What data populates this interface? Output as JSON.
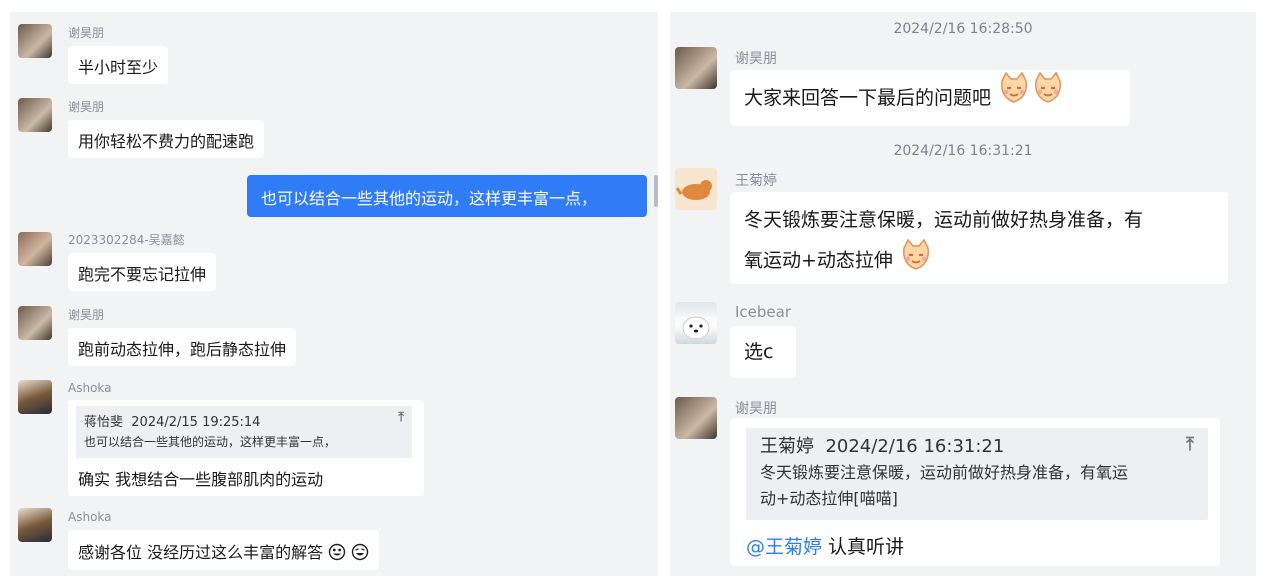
{
  "left": {
    "messages": [
      {
        "sender": "谢昊朋",
        "text": "半小时至少"
      },
      {
        "sender": "谢昊朋",
        "text": "用你轻松不费力的配速跑"
      },
      {
        "self": true,
        "text": "也可以结合一些其他的运动，这样更丰富一点，"
      },
      {
        "sender": "2023302284-吴嘉懿",
        "text": "跑完不要忘记拉伸"
      },
      {
        "sender": "谢昊朋",
        "text": "跑前动态拉伸，跑后静态拉伸"
      },
      {
        "sender": "Ashoka",
        "quote": {
          "author": "蒋怡斐",
          "time": "2024/2/15 19:25:14",
          "text": "也可以结合一些其他的运动，这样更丰富一点，"
        },
        "text": "确实 我想结合一些腹部肌肉的运动"
      },
      {
        "sender": "Ashoka",
        "text": "感谢各位 没经历过这么丰富的解答"
      }
    ]
  },
  "right": {
    "timestamp_1": "2024/2/16 16:28:50",
    "timestamp_2": "2024/2/16 16:31:21",
    "messages": [
      {
        "sender": "谢昊朋",
        "text": "大家来回答一下最后的问题吧"
      },
      {
        "sender": "王菊婷",
        "text_line1": "冬天锻炼要注意保暖，运动前做好热身准备，有",
        "text_line2": "氧运动+动态拉伸"
      },
      {
        "sender": "Icebear",
        "text": "选c"
      },
      {
        "sender": "谢昊朋",
        "quote": {
          "author": "王菊婷",
          "time": "2024/2/16 16:31:21",
          "line1": "冬天锻炼要注意保暖，运动前做好热身准备，有氧运",
          "line2": "动+动态拉伸[喵喵]"
        },
        "mention": "@王菊婷",
        "text": " 认真听讲"
      }
    ]
  },
  "icons": {
    "pin": "pin-to-top-icon",
    "emoji_cat": "cat-emoji-icon",
    "emoji_laugh": "grinning-emoji-icon"
  },
  "colors": {
    "self_bubble": "#2f7cf6",
    "mention": "#2f7cf6",
    "background": "#f2f3f5"
  }
}
